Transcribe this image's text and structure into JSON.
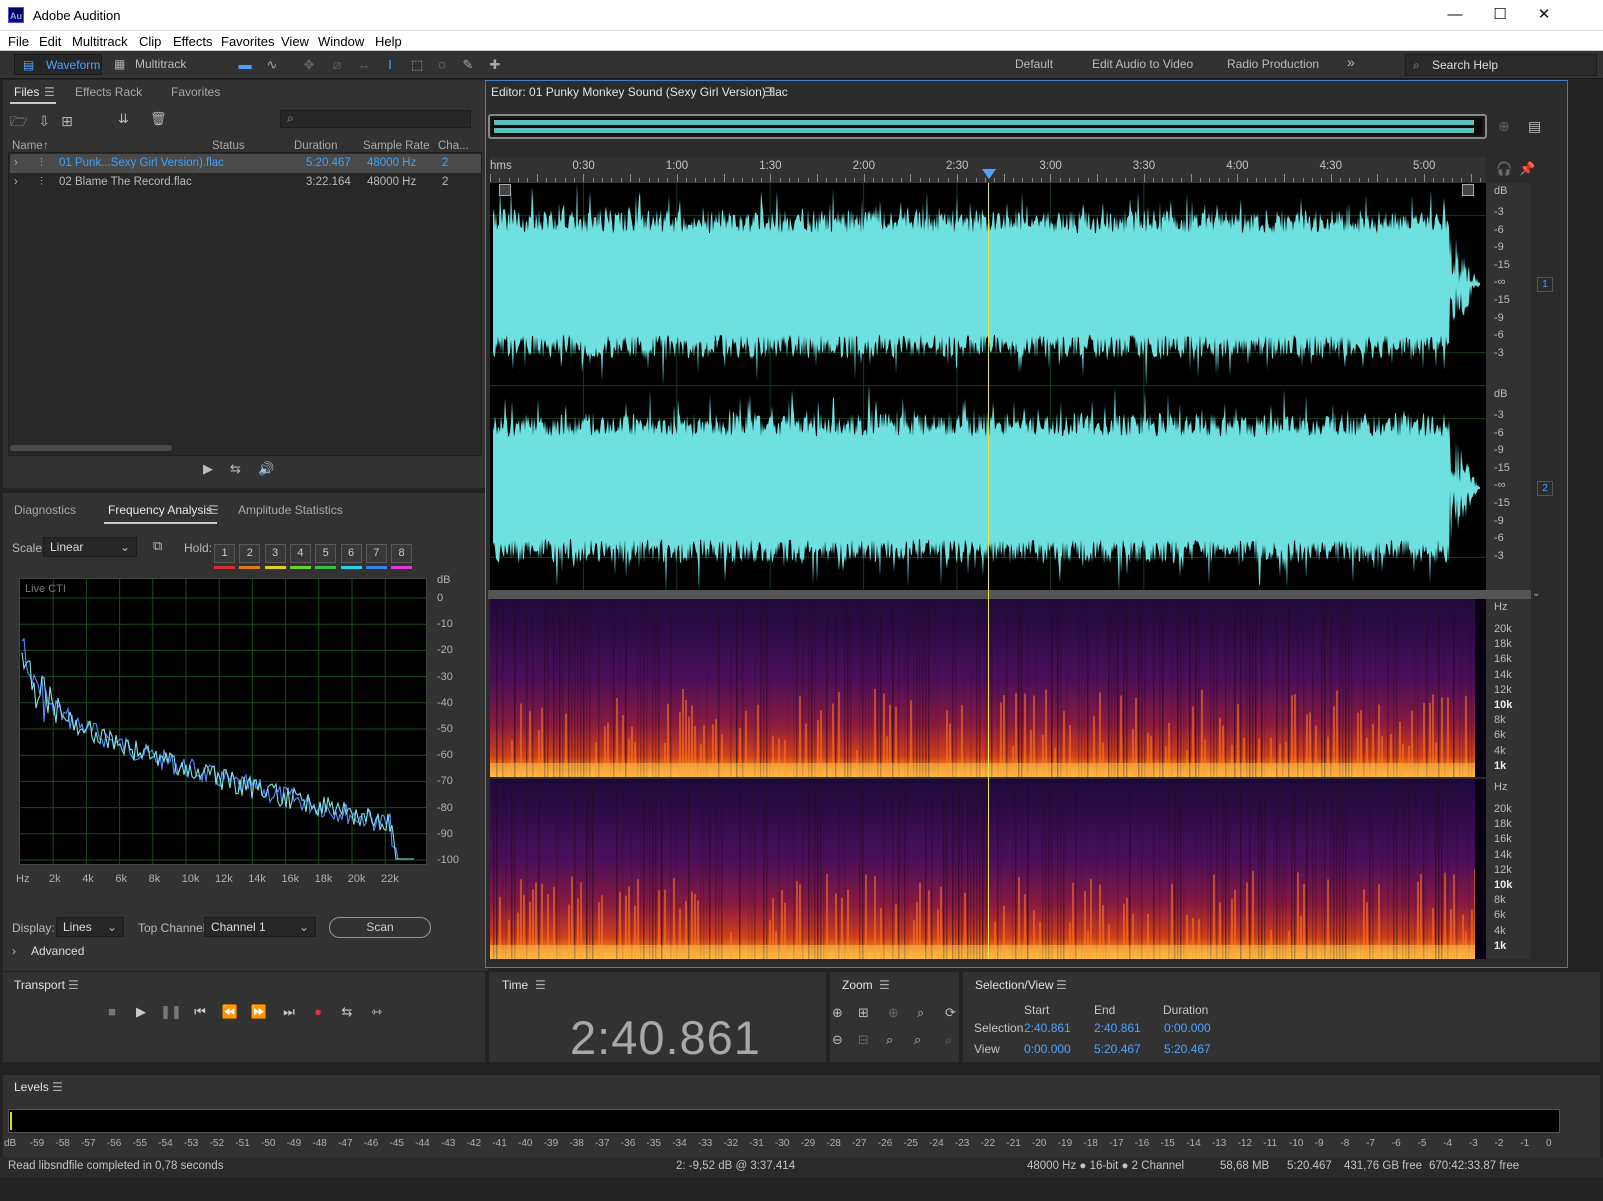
{
  "window": {
    "app_icon": "Au",
    "title": "Adobe Audition",
    "minimize": "—",
    "maximize": "☐",
    "close": "✕"
  },
  "menu": [
    "File",
    "Edit",
    "Multitrack",
    "Clip",
    "Effects",
    "Favorites",
    "View",
    "Window",
    "Help"
  ],
  "toolbar": {
    "waveform": "Waveform",
    "multitrack": "Multitrack",
    "workspaces": [
      "Default",
      "Edit Audio to Video",
      "Radio Production"
    ],
    "more": "»",
    "search_placeholder": "Search Help"
  },
  "files_panel": {
    "tabs": [
      "Files",
      "Effects Rack",
      "Favorites"
    ],
    "search_placeholder": "",
    "columns": {
      "name": "Name",
      "status": "Status",
      "duration": "Duration",
      "sample_rate": "Sample Rate",
      "channels": "Cha..."
    },
    "rows": [
      {
        "name": "01 Punk...Sexy Girl Version).flac",
        "status": "",
        "duration": "5:20.467",
        "sample_rate": "48000 Hz",
        "channels": "2",
        "selected": true
      },
      {
        "name": "02 Blame The Record.flac",
        "status": "",
        "duration": "3:22.164",
        "sample_rate": "48000 Hz",
        "channels": "2",
        "selected": false
      }
    ]
  },
  "analysis_panel": {
    "tabs": [
      "Diagnostics",
      "Frequency Analysis",
      "Amplitude Statistics"
    ],
    "scale_label": "Scale:",
    "scale_value": "Linear",
    "hold_label": "Hold:",
    "hold_buttons": [
      "1",
      "2",
      "3",
      "4",
      "5",
      "6",
      "7",
      "8"
    ],
    "hold_colors": [
      "#d62c2c",
      "#e07b1e",
      "#e1d020",
      "#6ccf2a",
      "#3fbf49",
      "#29d1e0",
      "#3a82e6",
      "#e03ad8"
    ],
    "graph_label": "Live CTI",
    "db_label": "dB",
    "db_ticks": [
      "0",
      "-10",
      "-20",
      "-30",
      "-40",
      "-50",
      "-60",
      "-70",
      "-80",
      "-90",
      "-100"
    ],
    "hz_ticks": [
      "Hz",
      "2k",
      "4k",
      "6k",
      "8k",
      "10k",
      "12k",
      "14k",
      "16k",
      "18k",
      "20k",
      "22k"
    ],
    "display_label": "Display:",
    "display_value": "Lines",
    "top_channel_label": "Top Channel:",
    "top_channel_value": "Channel 1",
    "scan": "Scan",
    "advanced": "Advanced"
  },
  "editor": {
    "title": "Editor: 01 Punky Monkey Sound (Sexy Girl Version).flac",
    "ruler": [
      "hms",
      "0:30",
      "1:00",
      "1:30",
      "2:00",
      "2:30",
      "3:00",
      "3:30",
      "4:00",
      "4:30",
      "5:00"
    ],
    "db_label": "dB",
    "db_scale": [
      "-3",
      "-6",
      "-9",
      "-15",
      "-∞",
      "-15",
      "-9",
      "-6",
      "-3"
    ],
    "ch1": "1",
    "ch2": "2",
    "hz_label": "Hz",
    "hz_scale": [
      "20k",
      "18k",
      "16k",
      "14k",
      "12k",
      "10k",
      "8k",
      "6k",
      "4k",
      "1k"
    ],
    "waveform_color": "#6fe0e0"
  },
  "transport": {
    "title": "Transport"
  },
  "time": {
    "title": "Time",
    "value": "2:40.861"
  },
  "zoom": {
    "title": "Zoom"
  },
  "selection_view": {
    "title": "Selection/View",
    "start": "Start",
    "end": "End",
    "duration": "Duration",
    "selection_label": "Selection",
    "selection_start": "2:40.861",
    "selection_end": "2:40.861",
    "selection_duration": "0:00.000",
    "view_label": "View",
    "view_start": "0:00.000",
    "view_end": "5:20.467",
    "view_duration": "5:20.467"
  },
  "levels": {
    "title": "Levels",
    "scale": [
      "dB",
      "-59",
      "-58",
      "-57",
      "-56",
      "-55",
      "-54",
      "-53",
      "-52",
      "-51",
      "-50",
      "-49",
      "-48",
      "-47",
      "-46",
      "-45",
      "-44",
      "-43",
      "-42",
      "-41",
      "-40",
      "-39",
      "-38",
      "-37",
      "-36",
      "-35",
      "-34",
      "-33",
      "-32",
      "-31",
      "-30",
      "-29",
      "-28",
      "-27",
      "-26",
      "-25",
      "-24",
      "-23",
      "-22",
      "-21",
      "-20",
      "-19",
      "-18",
      "-17",
      "-16",
      "-15",
      "-14",
      "-13",
      "-12",
      "-11",
      "-10",
      "-9",
      "-8",
      "-7",
      "-6",
      "-5",
      "-4",
      "-3",
      "-2",
      "-1",
      "0"
    ]
  },
  "status": {
    "message": "Read libsndfile completed in 0,78 seconds",
    "cursor": "2: -9,52 dB @ 3:37.414",
    "format": "48000 Hz ● 16-bit ● 2 Channel",
    "size": "58,68 MB",
    "duration": "5:20.467",
    "free": "431,76 GB free",
    "time_free": "670:42:33.87 free"
  }
}
